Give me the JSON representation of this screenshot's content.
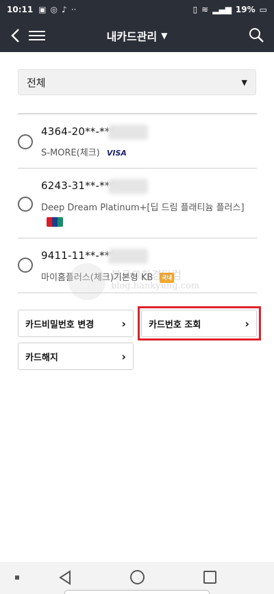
{
  "status_bar": {
    "time": "10:11",
    "battery": "19%"
  },
  "header": {
    "title": "내카드관리"
  },
  "filter": {
    "selected": "전체"
  },
  "cards": [
    {
      "number": "4364-20**-***",
      "name": "S-MORE(체크)",
      "brand": "VISA"
    },
    {
      "number": "6243-31**-***",
      "name": "Deep Dream Platinum+[딥 드림 플래티늄 플러스]",
      "brand": "UnionPay"
    },
    {
      "number": "9411-11**-***",
      "name": "마이홈플러스(체크)기본형 KB",
      "brand": "국내"
    }
  ],
  "actions": {
    "change_pin": "카드비밀번호 변경",
    "view_number": "카드번호 조회",
    "cancel_card": "카드해지"
  },
  "watermark": {
    "line1": "블로그한경닷컴",
    "line2": "blog.hankyung.com"
  },
  "colors": {
    "header_bg": "#2b2f38",
    "highlight": "#e0202a"
  }
}
